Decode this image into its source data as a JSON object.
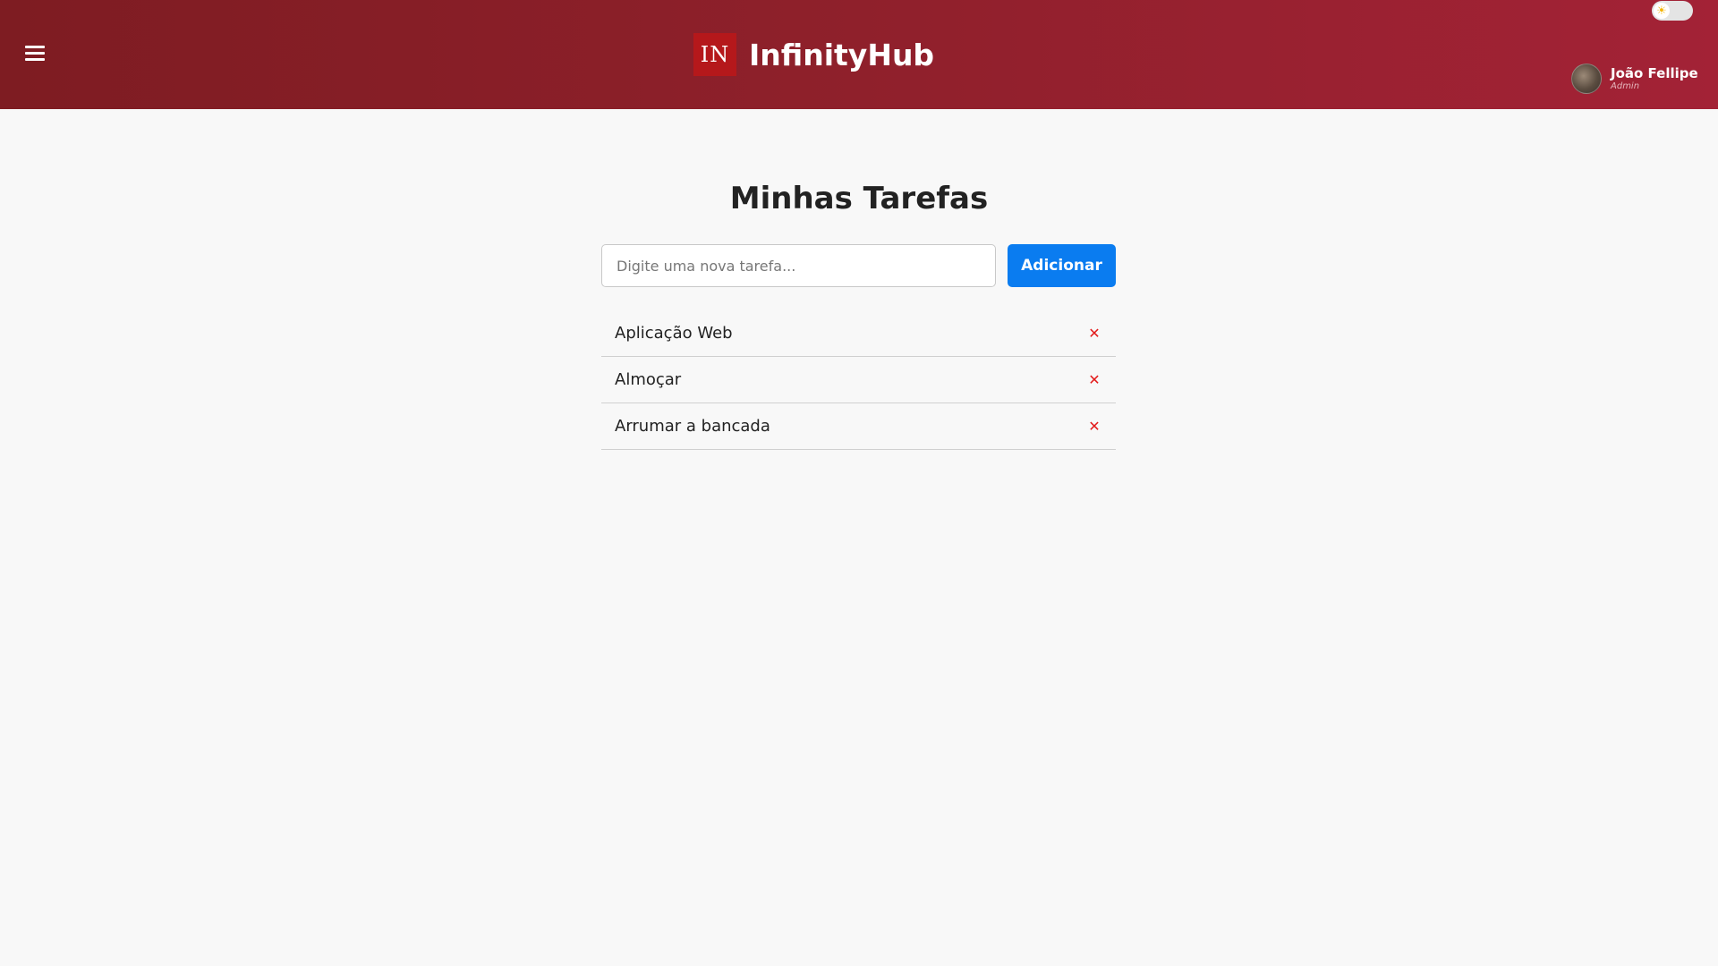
{
  "header": {
    "logo_text": "IN",
    "brand": "InfinityHub",
    "user": {
      "name": "João Fellipe",
      "role": "Admin"
    },
    "theme_toggle_icon": "☀"
  },
  "main": {
    "title": "Minhas Tarefas",
    "input_placeholder": "Digite uma nova tarefa...",
    "add_button": "Adicionar",
    "tasks": [
      {
        "text": "Aplicação Web",
        "delete_icon": "✕"
      },
      {
        "text": "Almoçar",
        "delete_icon": "✕"
      },
      {
        "text": "Arrumar a bancada",
        "delete_icon": "✕"
      }
    ]
  },
  "colors": {
    "header_start": "#7e1c22",
    "header_end": "#a32236",
    "logo_bg": "#b5181b",
    "primary_button": "#0a7cf0",
    "delete": "#e31b1b"
  }
}
